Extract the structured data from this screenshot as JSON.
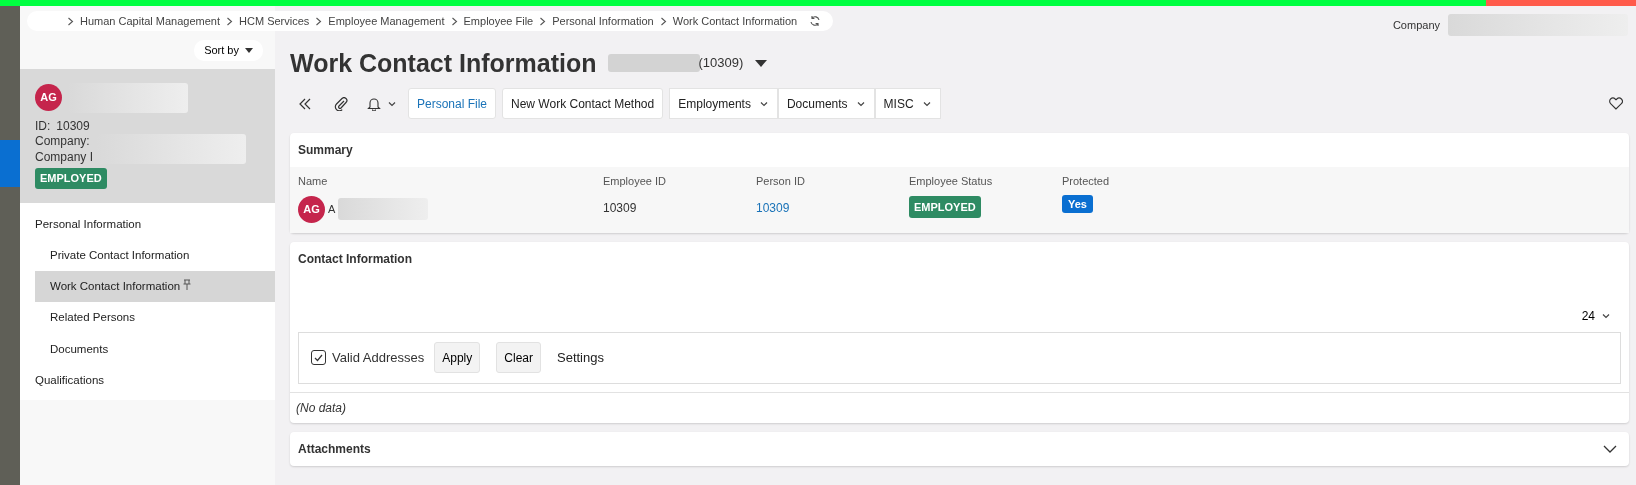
{
  "breadcrumb": [
    "Human Capital Management",
    "HCM Services",
    "Employee Management",
    "Employee File",
    "Personal Information",
    "Work Contact Information"
  ],
  "company_label": "Company",
  "sidebar": {
    "sort_label": "Sort by",
    "profile": {
      "initials": "AG",
      "id_label": "ID:",
      "id": "10309",
      "company_label": "Company:",
      "company_id_label": "Company I",
      "status": "EMPLOYED"
    },
    "nav": [
      {
        "label": "Personal Information",
        "selected": false,
        "pinned": false,
        "children": [
          {
            "label": "Private Contact Information",
            "selected": false,
            "pinned": false
          },
          {
            "label": "Work Contact Information",
            "selected": true,
            "pinned": true
          },
          {
            "label": "Related Persons",
            "selected": false,
            "pinned": false
          },
          {
            "label": "Documents",
            "selected": false,
            "pinned": false
          }
        ]
      },
      {
        "label": "Qualifications",
        "selected": false,
        "pinned": false
      }
    ]
  },
  "page": {
    "title": "Work Contact Information",
    "id_suffix": "(10309)"
  },
  "toolbar": [
    {
      "kind": "link",
      "label": "Personal File",
      "dropdown": false
    },
    {
      "kind": "button",
      "label": "New Work Contact Method",
      "dropdown": false
    },
    {
      "kind": "button",
      "label": "Employments",
      "dropdown": true
    },
    {
      "kind": "button",
      "label": "Documents",
      "dropdown": true
    },
    {
      "kind": "button",
      "label": "MISC",
      "dropdown": true
    }
  ],
  "summary": {
    "title": "Summary",
    "fields": [
      {
        "kind": "person",
        "label": "Name",
        "initials": "AG",
        "value": "A"
      },
      {
        "kind": "text",
        "label": "Employee ID",
        "value": "10309"
      },
      {
        "kind": "link",
        "label": "Person ID",
        "value": "10309"
      },
      {
        "kind": "status",
        "label": "Employee Status",
        "value": "EMPLOYED"
      },
      {
        "kind": "flag",
        "label": "Protected",
        "value": "Yes"
      }
    ]
  },
  "contact": {
    "title": "Contact Information",
    "page_size": "24",
    "filter": {
      "label": "Valid Addresses",
      "checked": true
    },
    "buttons": [
      "Apply",
      "Clear"
    ],
    "settings": "Settings",
    "empty": "(No data)"
  },
  "attachments": {
    "title": "Attachments",
    "expanded": false
  }
}
